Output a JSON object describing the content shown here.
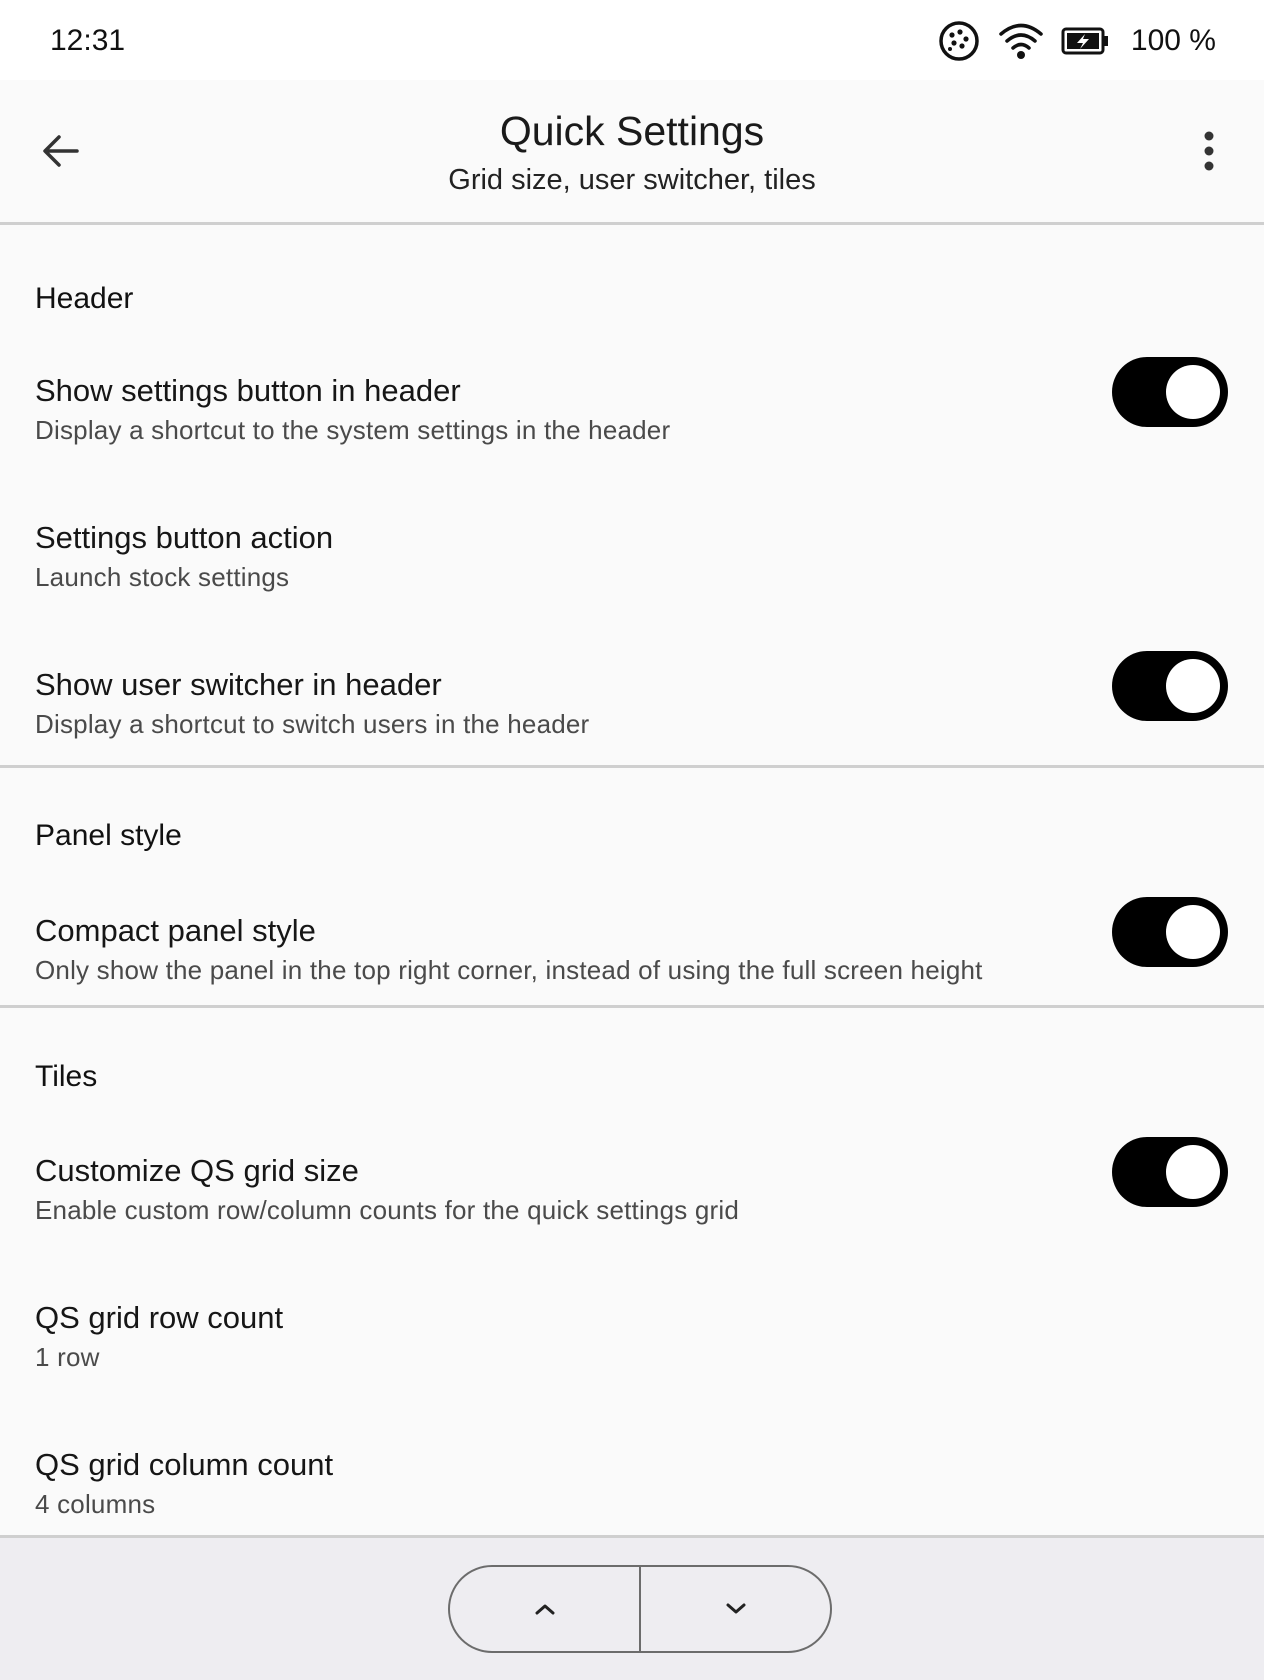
{
  "status_bar": {
    "time": "12:31",
    "battery_text": "100 %",
    "icons": [
      "data-saver-icon",
      "wifi-icon",
      "battery-charging-icon"
    ]
  },
  "app_bar": {
    "title": "Quick Settings",
    "subtitle": "Grid size, user switcher, tiles",
    "back_icon": "arrow-back-icon",
    "menu_icon": "more-vertical-icon"
  },
  "sections": {
    "header": {
      "title": "Header",
      "show_settings_button": {
        "title": "Show settings button in header",
        "summary": "Display a shortcut to the system settings in the header",
        "enabled": true
      },
      "settings_button_action": {
        "title": "Settings button action",
        "summary": "Launch stock settings"
      },
      "show_user_switcher": {
        "title": "Show user switcher in header",
        "summary": "Display a shortcut to switch users in the header",
        "enabled": true
      }
    },
    "panel_style": {
      "title": "Panel style",
      "compact": {
        "title": "Compact panel style",
        "summary": "Only show the panel in the top right corner, instead of using the full screen height",
        "enabled": true
      }
    },
    "tiles": {
      "title": "Tiles",
      "custom_grid": {
        "title": "Customize QS grid size",
        "summary": "Enable custom row/column counts for the quick settings grid",
        "enabled": true
      },
      "row_count": {
        "title": "QS grid row count",
        "summary": "1 row"
      },
      "column_count": {
        "title": "QS grid column count",
        "summary": "4 columns"
      }
    }
  },
  "bottom_bar": {
    "up_icon": "chevron-up-icon",
    "down_icon": "chevron-down-icon"
  }
}
